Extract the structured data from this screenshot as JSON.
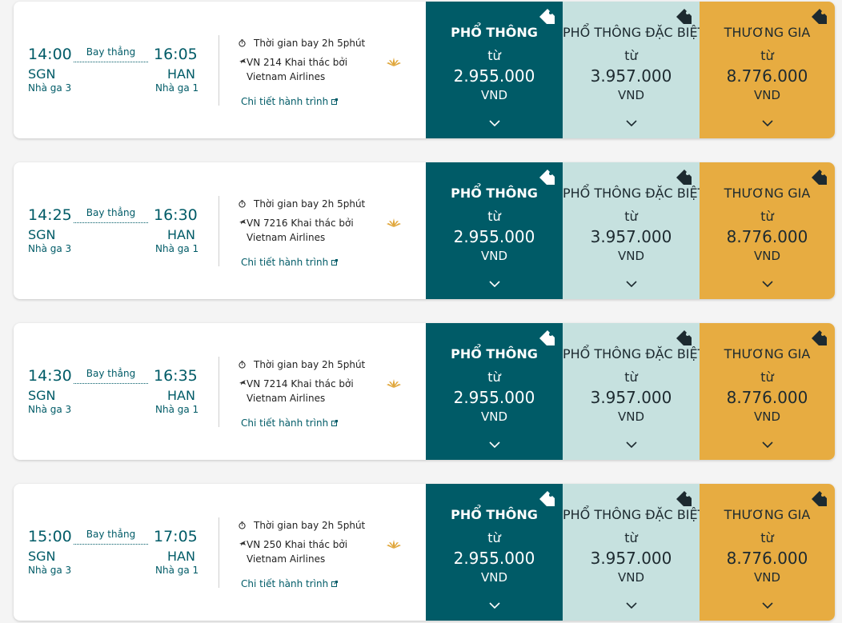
{
  "fare_labels": {
    "economy": "PHỔ THÔNG",
    "premium_economy": "PHỔ THÔNG ĐẶC BIỆT",
    "business": "THƯƠNG GIA",
    "from": "từ",
    "currency": "VND"
  },
  "colors": {
    "economy_bg": "#005b67",
    "premium_economy_bg": "#c6e1df",
    "business_bg": "#e7ac41",
    "brand_text": "#005b67"
  },
  "icons": {
    "duration": "stopwatch-icon",
    "flight": "plane-icon",
    "link": "external-link-icon",
    "airline": "vietnam-airlines-lotus-logo",
    "fare_tag": "price-tag-icon",
    "expand": "chevron-down-icon"
  },
  "flights": [
    {
      "dep_time": "14:00",
      "dep_code": "SGN",
      "dep_terminal": "Nhà ga 3",
      "stop_label": "Bay thẳng",
      "arr_time": "16:05",
      "arr_code": "HAN",
      "arr_terminal": "Nhà ga 1",
      "duration": "Thời gian bay 2h 5phút",
      "flight_info": "VN 214 Khai thác bởi Vietnam Airlines",
      "details_link": "Chi tiết hành trình",
      "prices": {
        "economy": "2.955.000",
        "premium_economy": "3.957.000",
        "business": "8.776.000"
      }
    },
    {
      "dep_time": "14:25",
      "dep_code": "SGN",
      "dep_terminal": "Nhà ga 3",
      "stop_label": "Bay thẳng",
      "arr_time": "16:30",
      "arr_code": "HAN",
      "arr_terminal": "Nhà ga 1",
      "duration": "Thời gian bay 2h 5phút",
      "flight_info": "VN 7216 Khai thác bởi Vietnam Airlines",
      "details_link": "Chi tiết hành trình",
      "prices": {
        "economy": "2.955.000",
        "premium_economy": "3.957.000",
        "business": "8.776.000"
      }
    },
    {
      "dep_time": "14:30",
      "dep_code": "SGN",
      "dep_terminal": "Nhà ga 3",
      "stop_label": "Bay thẳng",
      "arr_time": "16:35",
      "arr_code": "HAN",
      "arr_terminal": "Nhà ga 1",
      "duration": "Thời gian bay 2h 5phút",
      "flight_info": "VN 7214 Khai thác bởi Vietnam Airlines",
      "details_link": "Chi tiết hành trình",
      "prices": {
        "economy": "2.955.000",
        "premium_economy": "3.957.000",
        "business": "8.776.000"
      }
    },
    {
      "dep_time": "15:00",
      "dep_code": "SGN",
      "dep_terminal": "Nhà ga 3",
      "stop_label": "Bay thẳng",
      "arr_time": "17:05",
      "arr_code": "HAN",
      "arr_terminal": "Nhà ga 1",
      "duration": "Thời gian bay 2h 5phút",
      "flight_info": "VN 250 Khai thác bởi Vietnam Airlines",
      "details_link": "Chi tiết hành trình",
      "prices": {
        "economy": "2.955.000",
        "premium_economy": "3.957.000",
        "business": "8.776.000"
      }
    }
  ]
}
